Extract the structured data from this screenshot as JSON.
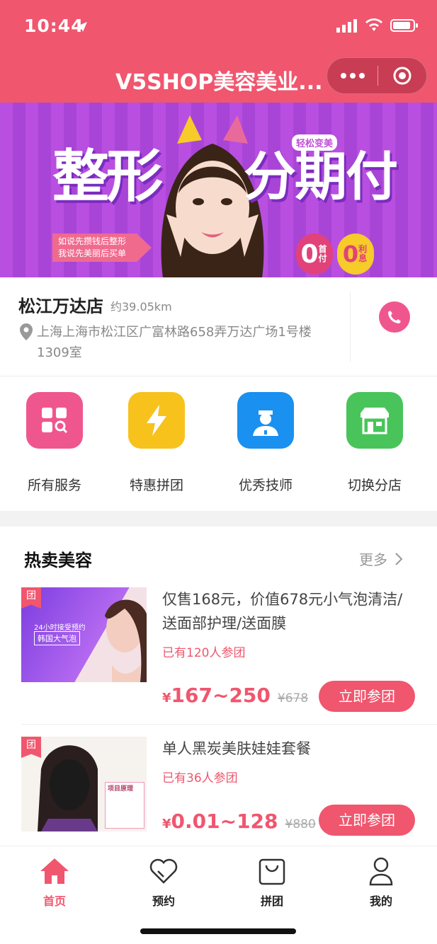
{
  "status": {
    "time": "10:44"
  },
  "header": {
    "title": "V5SHOP美容美业..."
  },
  "banner": {
    "headline_left": "整形",
    "headline_right": "分期付",
    "tag": "轻松变美",
    "arrow_text_1": "如说先攒钱后整形",
    "arrow_text_2": "我说先美丽后买单",
    "badge_zero_1": "0",
    "badge_label_1": "首付",
    "badge_zero_2": "0",
    "badge_label_2": "利息"
  },
  "store": {
    "name": "松江万达店",
    "distance": "约39.05km",
    "address": "上海上海市松江区广富林路658弄万达广场1号楼1309室"
  },
  "menu": [
    {
      "label": "所有服务",
      "icon": "grid-search-icon",
      "color": "#f0568e"
    },
    {
      "label": "特惠拼团",
      "icon": "lightning-icon",
      "color": "#f8c21c"
    },
    {
      "label": "优秀技师",
      "icon": "nurse-icon",
      "color": "#1a90f0"
    },
    {
      "label": "切换分店",
      "icon": "storefront-icon",
      "color": "#49c45a"
    }
  ],
  "section": {
    "title": "热卖美容",
    "more": "更多"
  },
  "products": [
    {
      "tag": "团",
      "image_text_1": "24小时接受预约",
      "image_text_2": "韩国大气泡",
      "name": "仅售168元，价值678元小气泡清洁/送面部护理/送面膜",
      "joined": "已有120人参团",
      "price_symbol": "¥",
      "price": "167~250",
      "orig": "¥678",
      "btn": "立即参团"
    },
    {
      "tag": "团",
      "image_text_1": "项目原理",
      "name": "单人黑炭美肤娃娃套餐",
      "joined": "已有36人参团",
      "price_symbol": "¥",
      "price": "0.01~128",
      "orig": "¥880",
      "btn": "立即参团"
    }
  ],
  "tabs": [
    {
      "label": "首页",
      "icon": "home-icon"
    },
    {
      "label": "预约",
      "icon": "heart-icon"
    },
    {
      "label": "拼团",
      "icon": "bag-icon"
    },
    {
      "label": "我的",
      "icon": "user-icon"
    }
  ],
  "colors": {
    "accent": "#f0566e"
  }
}
